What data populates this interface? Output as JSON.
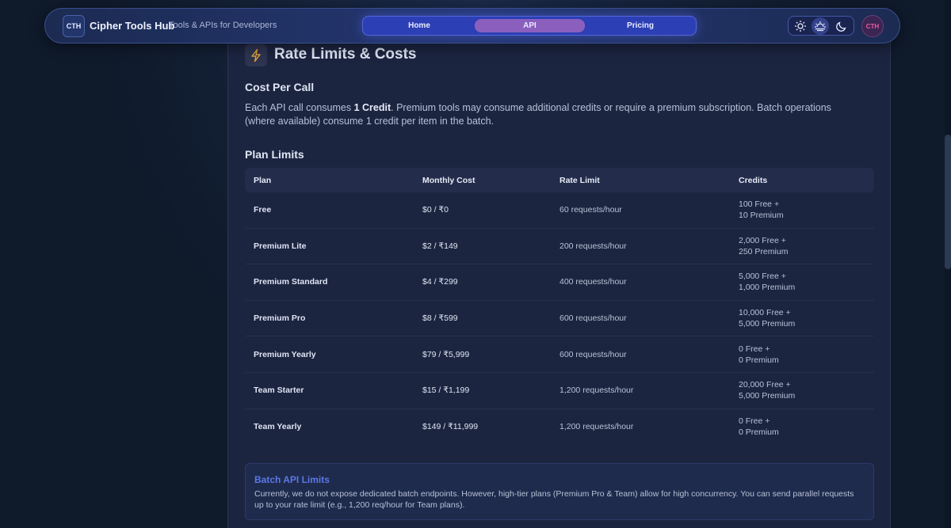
{
  "header": {
    "logo_text": "CTH",
    "brand": "Cipher Tools Hub",
    "tagline": "Tools & APIs for Developers",
    "nav": [
      {
        "label": "Home"
      },
      {
        "label": "API"
      },
      {
        "label": "Pricing"
      }
    ],
    "theme_icons": [
      "sun-icon",
      "sunset-icon",
      "moon-icon"
    ],
    "avatar_text": "CTH"
  },
  "card": {
    "icon": "lightning-icon",
    "title": "Rate Limits & Costs",
    "cost_heading": "Cost Per Call",
    "cost_text_pre": "Each API call consumes ",
    "cost_text_bold": "1 Credit",
    "cost_text_post": ". Premium tools may consume additional credits or require a premium subscription. Batch operations (where available) consume 1 credit per item in the batch.",
    "plan_heading": "Plan Limits",
    "table": {
      "headers": [
        "Plan",
        "Monthly Cost",
        "Rate Limit",
        "Credits"
      ],
      "rows": [
        {
          "plan": "Free",
          "cost": "$0 / ₹0",
          "rate": "60 requests/hour",
          "credits_1": "100 Free +",
          "credits_2": "10 Premium"
        },
        {
          "plan": "Premium Lite",
          "cost": "$2 / ₹149",
          "rate": "200 requests/hour",
          "credits_1": "2,000 Free +",
          "credits_2": "250 Premium"
        },
        {
          "plan": "Premium Standard",
          "cost": "$4 / ₹299",
          "rate": "400 requests/hour",
          "credits_1": "5,000 Free +",
          "credits_2": "1,000 Premium"
        },
        {
          "plan": "Premium Pro",
          "cost": "$8 / ₹599",
          "rate": "600 requests/hour",
          "credits_1": "10,000 Free +",
          "credits_2": "5,000 Premium"
        },
        {
          "plan": "Premium Yearly",
          "cost": "$79 / ₹5,999",
          "rate": "600 requests/hour",
          "credits_1": "0 Free +",
          "credits_2": "0 Premium"
        },
        {
          "plan": "Team Starter",
          "cost": "$15 / ₹1,199",
          "rate": "1,200 requests/hour",
          "credits_1": "20,000 Free +",
          "credits_2": "5,000 Premium"
        },
        {
          "plan": "Team Yearly",
          "cost": "$149 / ₹11,999",
          "rate": "1,200 requests/hour",
          "credits_1": "0 Free +",
          "credits_2": "0 Premium"
        }
      ]
    },
    "batch": {
      "title": "Batch API Limits",
      "text": "Currently, we do not expose dedicated batch endpoints. However, high-tier plans (Premium Pro & Team) allow for high concurrency. You can send parallel requests up to your rate limit (e.g., 1,200 req/hour for Team plans)."
    }
  },
  "colors": {
    "background": "#0f1a2b",
    "card": "#1c2540",
    "nav_accent": "#2c3fb4",
    "active_tab": "#8b5fbe",
    "batch_title": "#5b78e6"
  }
}
